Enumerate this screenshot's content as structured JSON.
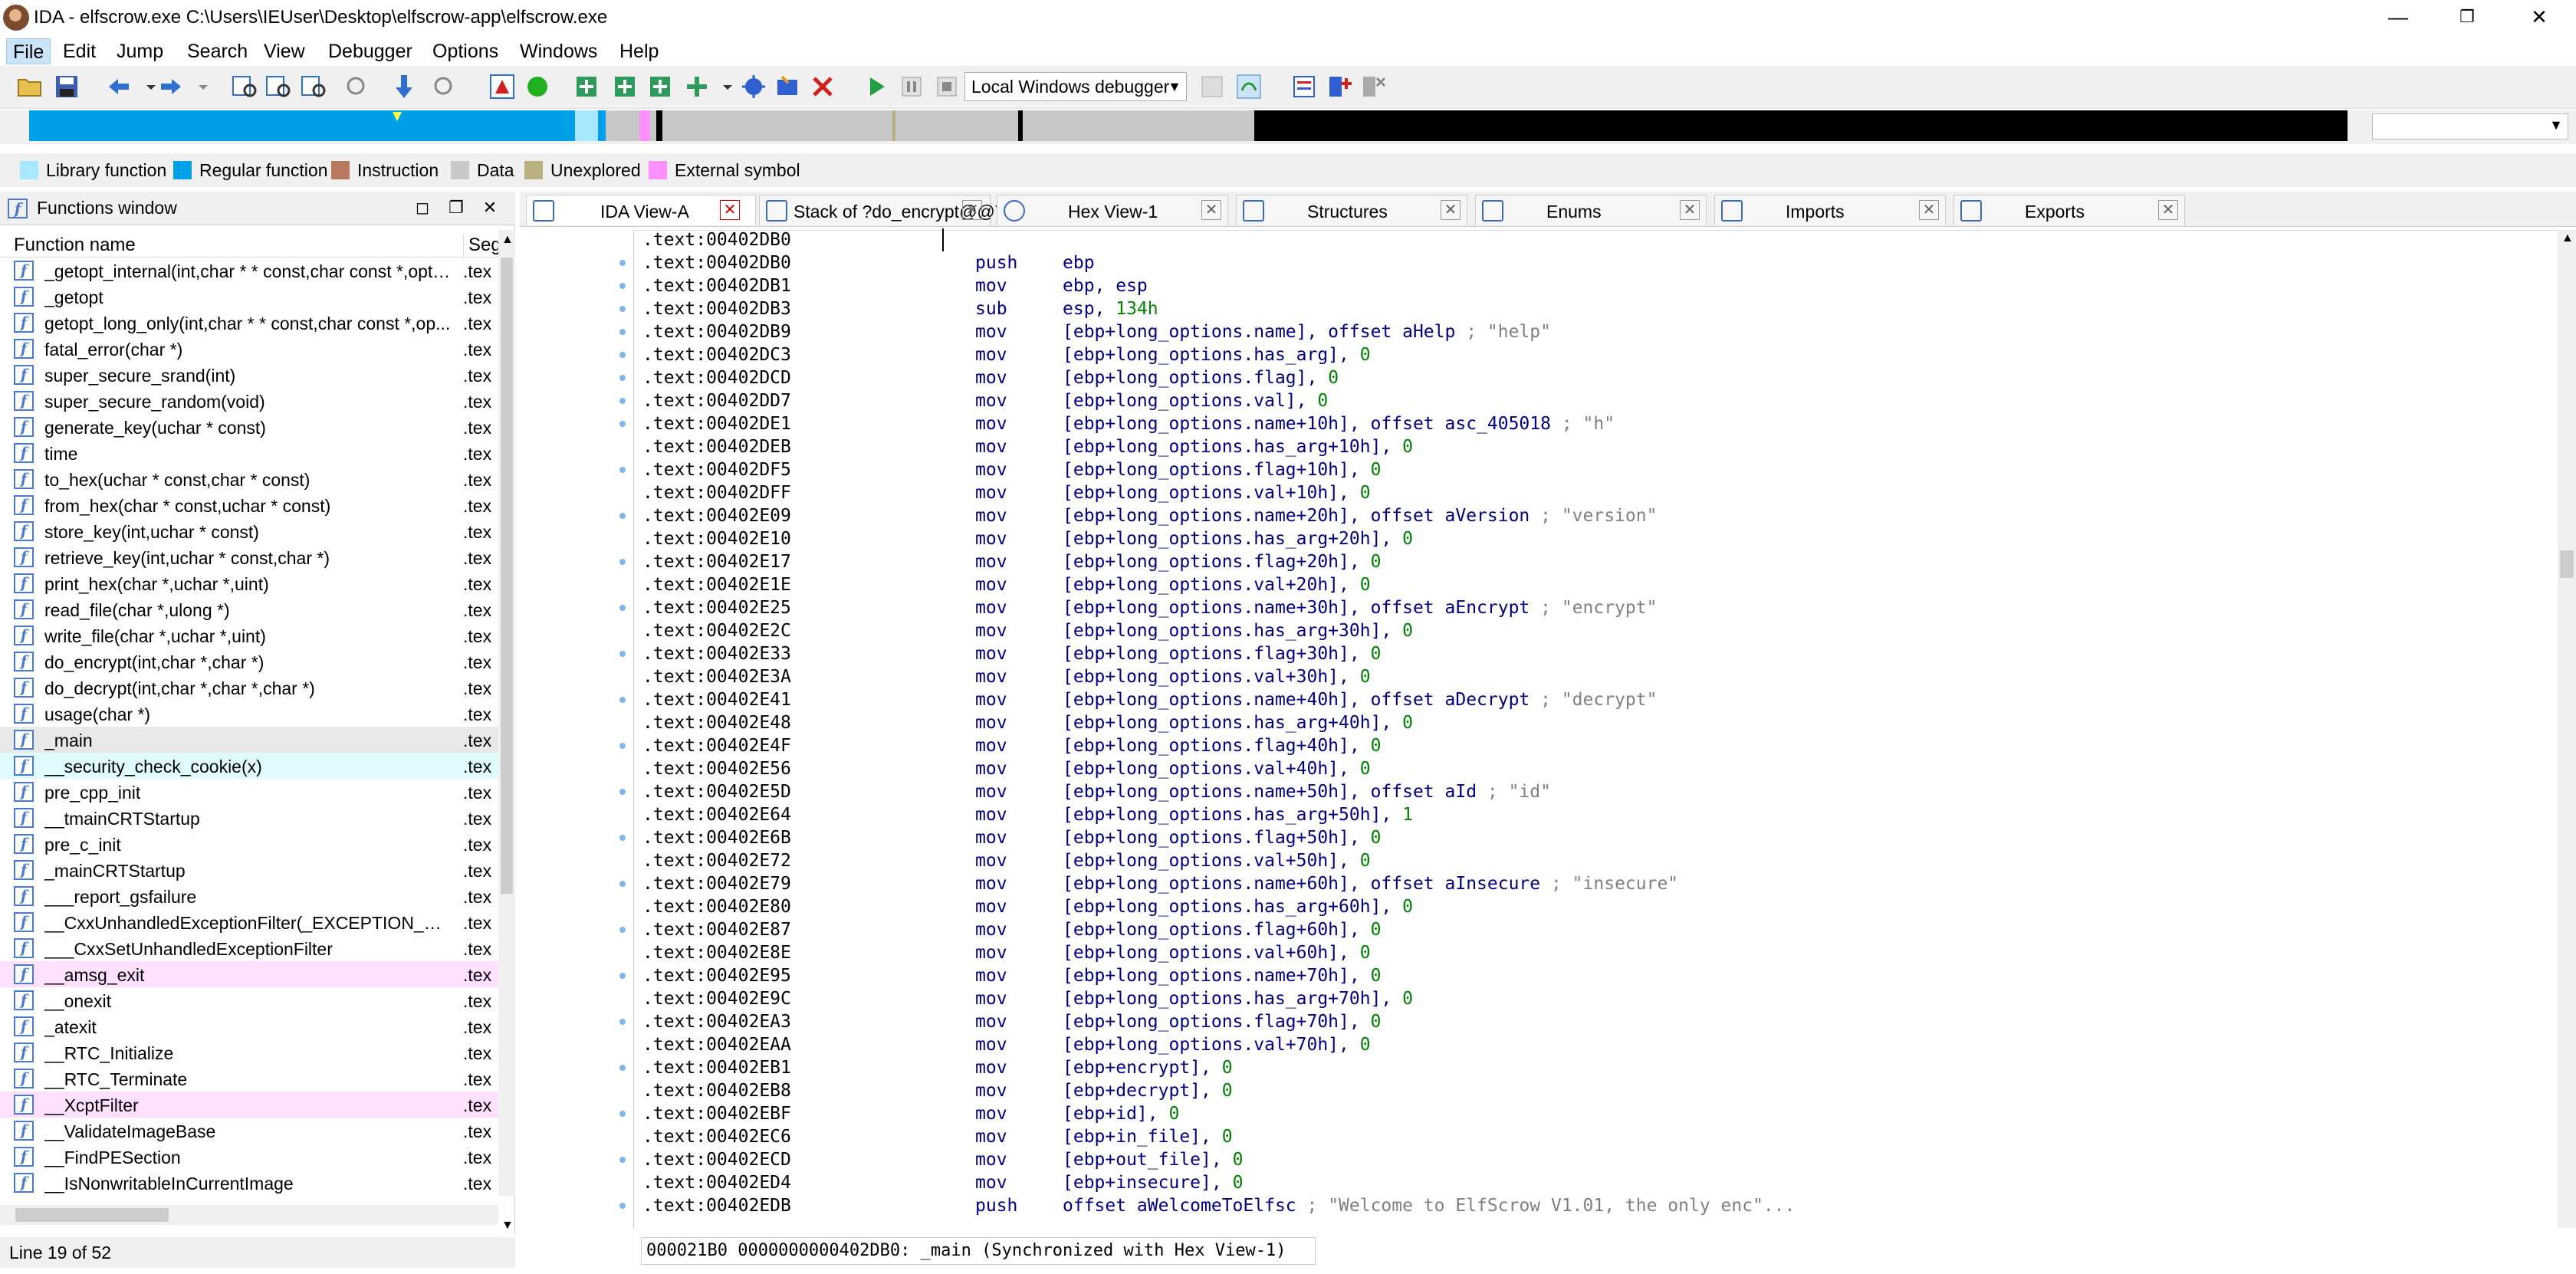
{
  "window": {
    "title": "IDA - elfscrow.exe C:\\Users\\IEUser\\Desktop\\elfscrow-app\\elfscrow.exe",
    "minimize": "—",
    "maximize": "❐",
    "close": "✕"
  },
  "menu": [
    "File",
    "Edit",
    "Jump",
    "Search",
    "View",
    "Debugger",
    "Options",
    "Windows",
    "Help"
  ],
  "toolbar": {
    "debugger_select": "Local Windows debugger"
  },
  "legend": [
    {
      "label": "Library function",
      "color": "#a8e8ff"
    },
    {
      "label": "Regular function",
      "color": "#00a0e8"
    },
    {
      "label": "Instruction",
      "color": "#b87860"
    },
    {
      "label": "Data",
      "color": "#c8c8c8"
    },
    {
      "label": "Unexplored",
      "color": "#b8b080"
    },
    {
      "label": "External symbol",
      "color": "#ff90ff"
    }
  ],
  "functions_window": {
    "title": "Functions window",
    "col_name": "Function name",
    "col_seg": "Seg",
    "rows": [
      {
        "name": "_getopt_internal(int,char * * const,char const *,opti...",
        "seg": ".tex",
        "hl": ""
      },
      {
        "name": "_getopt",
        "seg": ".tex",
        "hl": ""
      },
      {
        "name": "getopt_long_only(int,char * * const,char const *,op...",
        "seg": ".tex",
        "hl": ""
      },
      {
        "name": "fatal_error(char *)",
        "seg": ".tex",
        "hl": ""
      },
      {
        "name": "super_secure_srand(int)",
        "seg": ".tex",
        "hl": ""
      },
      {
        "name": "super_secure_random(void)",
        "seg": ".tex",
        "hl": ""
      },
      {
        "name": "generate_key(uchar * const)",
        "seg": ".tex",
        "hl": ""
      },
      {
        "name": "time",
        "seg": ".tex",
        "hl": ""
      },
      {
        "name": "to_hex(uchar * const,char * const)",
        "seg": ".tex",
        "hl": ""
      },
      {
        "name": "from_hex(char * const,uchar * const)",
        "seg": ".tex",
        "hl": ""
      },
      {
        "name": "store_key(int,uchar * const)",
        "seg": ".tex",
        "hl": ""
      },
      {
        "name": "retrieve_key(int,uchar * const,char *)",
        "seg": ".tex",
        "hl": ""
      },
      {
        "name": "print_hex(char *,uchar *,uint)",
        "seg": ".tex",
        "hl": ""
      },
      {
        "name": "read_file(char *,ulong *)",
        "seg": ".tex",
        "hl": ""
      },
      {
        "name": "write_file(char *,uchar *,uint)",
        "seg": ".tex",
        "hl": ""
      },
      {
        "name": "do_encrypt(int,char *,char *)",
        "seg": ".tex",
        "hl": ""
      },
      {
        "name": "do_decrypt(int,char *,char *,char *)",
        "seg": ".tex",
        "hl": ""
      },
      {
        "name": "usage(char *)",
        "seg": ".tex",
        "hl": ""
      },
      {
        "name": "_main",
        "seg": ".tex",
        "hl": "sel"
      },
      {
        "name": "__security_check_cookie(x)",
        "seg": ".tex",
        "hl": "lib"
      },
      {
        "name": "pre_cpp_init",
        "seg": ".tex",
        "hl": ""
      },
      {
        "name": "__tmainCRTStartup",
        "seg": ".tex",
        "hl": ""
      },
      {
        "name": "pre_c_init",
        "seg": ".tex",
        "hl": ""
      },
      {
        "name": "_mainCRTStartup",
        "seg": ".tex",
        "hl": ""
      },
      {
        "name": "___report_gsfailure",
        "seg": ".tex",
        "hl": ""
      },
      {
        "name": "__CxxUnhandledExceptionFilter(_EXCEPTION_POIN...",
        "seg": ".tex",
        "hl": ""
      },
      {
        "name": "___CxxSetUnhandledExceptionFilter",
        "seg": ".tex",
        "hl": ""
      },
      {
        "name": "__amsg_exit",
        "seg": ".tex",
        "hl": "ext"
      },
      {
        "name": "__onexit",
        "seg": ".tex",
        "hl": ""
      },
      {
        "name": "_atexit",
        "seg": ".tex",
        "hl": ""
      },
      {
        "name": "__RTC_Initialize",
        "seg": ".tex",
        "hl": ""
      },
      {
        "name": "__RTC_Terminate",
        "seg": ".tex",
        "hl": ""
      },
      {
        "name": "__XcptFilter",
        "seg": ".tex",
        "hl": "ext"
      },
      {
        "name": "__ValidateImageBase",
        "seg": ".tex",
        "hl": ""
      },
      {
        "name": "__FindPESection",
        "seg": ".tex",
        "hl": ""
      },
      {
        "name": "__IsNonwritableInCurrentImage",
        "seg": ".tex",
        "hl": ""
      }
    ],
    "status": "Line 19 of 52"
  },
  "tabs": [
    {
      "label": "IDA View-A"
    },
    {
      "label": "Stack of ?do_encrypt@@YAXHPAD0@Z"
    },
    {
      "label": "Hex View-1"
    },
    {
      "label": "Structures"
    },
    {
      "label": "Enums"
    },
    {
      "label": "Imports"
    },
    {
      "label": "Exports"
    }
  ],
  "code": [
    {
      "a": ".text:00402DB0",
      "m": "",
      "o": []
    },
    {
      "a": ".text:00402DB0",
      "m": "push",
      "o": [
        [
          "ebp",
          ""
        ]
      ]
    },
    {
      "a": ".text:00402DB1",
      "m": "mov",
      "o": [
        [
          "ebp, esp",
          ""
        ]
      ]
    },
    {
      "a": ".text:00402DB3",
      "m": "sub",
      "o": [
        [
          "esp, ",
          ""
        ],
        [
          "134h",
          "num"
        ]
      ]
    },
    {
      "a": ".text:00402DB9",
      "m": "mov",
      "o": [
        [
          "[ebp+long_options.name], offset aHelp ",
          ""
        ],
        [
          "; \"help\"",
          "cmt"
        ]
      ]
    },
    {
      "a": ".text:00402DC3",
      "m": "mov",
      "o": [
        [
          "[ebp+long_options.has_arg], ",
          ""
        ],
        [
          "0",
          "num"
        ]
      ]
    },
    {
      "a": ".text:00402DCD",
      "m": "mov",
      "o": [
        [
          "[ebp+long_options.flag], ",
          ""
        ],
        [
          "0",
          "num"
        ]
      ]
    },
    {
      "a": ".text:00402DD7",
      "m": "mov",
      "o": [
        [
          "[ebp+long_options.val], ",
          ""
        ],
        [
          "0",
          "num"
        ]
      ]
    },
    {
      "a": ".text:00402DE1",
      "m": "mov",
      "o": [
        [
          "[ebp+long_options.name+10h], offset asc_405018 ",
          ""
        ],
        [
          "; \"h\"",
          "cmt"
        ]
      ]
    },
    {
      "a": ".text:00402DEB",
      "m": "mov",
      "o": [
        [
          "[ebp+long_options.has_arg+10h], ",
          ""
        ],
        [
          "0",
          "num"
        ]
      ]
    },
    {
      "a": ".text:00402DF5",
      "m": "mov",
      "o": [
        [
          "[ebp+long_options.flag+10h], ",
          ""
        ],
        [
          "0",
          "num"
        ]
      ]
    },
    {
      "a": ".text:00402DFF",
      "m": "mov",
      "o": [
        [
          "[ebp+long_options.val+10h], ",
          ""
        ],
        [
          "0",
          "num"
        ]
      ]
    },
    {
      "a": ".text:00402E09",
      "m": "mov",
      "o": [
        [
          "[ebp+long_options.name+20h], offset aVersion ",
          ""
        ],
        [
          "; \"version\"",
          "cmt"
        ]
      ]
    },
    {
      "a": ".text:00402E10",
      "m": "mov",
      "o": [
        [
          "[ebp+long_options.has_arg+20h], ",
          ""
        ],
        [
          "0",
          "num"
        ]
      ]
    },
    {
      "a": ".text:00402E17",
      "m": "mov",
      "o": [
        [
          "[ebp+long_options.flag+20h], ",
          ""
        ],
        [
          "0",
          "num"
        ]
      ]
    },
    {
      "a": ".text:00402E1E",
      "m": "mov",
      "o": [
        [
          "[ebp+long_options.val+20h], ",
          ""
        ],
        [
          "0",
          "num"
        ]
      ]
    },
    {
      "a": ".text:00402E25",
      "m": "mov",
      "o": [
        [
          "[ebp+long_options.name+30h], offset aEncrypt ",
          ""
        ],
        [
          "; \"encrypt\"",
          "cmt"
        ]
      ]
    },
    {
      "a": ".text:00402E2C",
      "m": "mov",
      "o": [
        [
          "[ebp+long_options.has_arg+30h], ",
          ""
        ],
        [
          "0",
          "num"
        ]
      ]
    },
    {
      "a": ".text:00402E33",
      "m": "mov",
      "o": [
        [
          "[ebp+long_options.flag+30h], ",
          ""
        ],
        [
          "0",
          "num"
        ]
      ]
    },
    {
      "a": ".text:00402E3A",
      "m": "mov",
      "o": [
        [
          "[ebp+long_options.val+30h], ",
          ""
        ],
        [
          "0",
          "num"
        ]
      ]
    },
    {
      "a": ".text:00402E41",
      "m": "mov",
      "o": [
        [
          "[ebp+long_options.name+40h], offset aDecrypt ",
          ""
        ],
        [
          "; \"decrypt\"",
          "cmt"
        ]
      ]
    },
    {
      "a": ".text:00402E48",
      "m": "mov",
      "o": [
        [
          "[ebp+long_options.has_arg+40h], ",
          ""
        ],
        [
          "0",
          "num"
        ]
      ]
    },
    {
      "a": ".text:00402E4F",
      "m": "mov",
      "o": [
        [
          "[ebp+long_options.flag+40h], ",
          ""
        ],
        [
          "0",
          "num"
        ]
      ]
    },
    {
      "a": ".text:00402E56",
      "m": "mov",
      "o": [
        [
          "[ebp+long_options.val+40h], ",
          ""
        ],
        [
          "0",
          "num"
        ]
      ]
    },
    {
      "a": ".text:00402E5D",
      "m": "mov",
      "o": [
        [
          "[ebp+long_options.name+50h], offset aId ",
          ""
        ],
        [
          "; \"id\"",
          "cmt"
        ]
      ]
    },
    {
      "a": ".text:00402E64",
      "m": "mov",
      "o": [
        [
          "[ebp+long_options.has_arg+50h], ",
          ""
        ],
        [
          "1",
          "num"
        ]
      ]
    },
    {
      "a": ".text:00402E6B",
      "m": "mov",
      "o": [
        [
          "[ebp+long_options.flag+50h], ",
          ""
        ],
        [
          "0",
          "num"
        ]
      ]
    },
    {
      "a": ".text:00402E72",
      "m": "mov",
      "o": [
        [
          "[ebp+long_options.val+50h], ",
          ""
        ],
        [
          "0",
          "num"
        ]
      ]
    },
    {
      "a": ".text:00402E79",
      "m": "mov",
      "o": [
        [
          "[ebp+long_options.name+60h], offset aInsecure ",
          ""
        ],
        [
          "; \"insecure\"",
          "cmt"
        ]
      ]
    },
    {
      "a": ".text:00402E80",
      "m": "mov",
      "o": [
        [
          "[ebp+long_options.has_arg+60h], ",
          ""
        ],
        [
          "0",
          "num"
        ]
      ]
    },
    {
      "a": ".text:00402E87",
      "m": "mov",
      "o": [
        [
          "[ebp+long_options.flag+60h], ",
          ""
        ],
        [
          "0",
          "num"
        ]
      ]
    },
    {
      "a": ".text:00402E8E",
      "m": "mov",
      "o": [
        [
          "[ebp+long_options.val+60h], ",
          ""
        ],
        [
          "0",
          "num"
        ]
      ]
    },
    {
      "a": ".text:00402E95",
      "m": "mov",
      "o": [
        [
          "[ebp+long_options.name+70h], ",
          ""
        ],
        [
          "0",
          "num"
        ]
      ]
    },
    {
      "a": ".text:00402E9C",
      "m": "mov",
      "o": [
        [
          "[ebp+long_options.has_arg+70h], ",
          ""
        ],
        [
          "0",
          "num"
        ]
      ]
    },
    {
      "a": ".text:00402EA3",
      "m": "mov",
      "o": [
        [
          "[ebp+long_options.flag+70h], ",
          ""
        ],
        [
          "0",
          "num"
        ]
      ]
    },
    {
      "a": ".text:00402EAA",
      "m": "mov",
      "o": [
        [
          "[ebp+long_options.val+70h], ",
          ""
        ],
        [
          "0",
          "num"
        ]
      ]
    },
    {
      "a": ".text:00402EB1",
      "m": "mov",
      "o": [
        [
          "[ebp+encrypt], ",
          ""
        ],
        [
          "0",
          "num"
        ]
      ]
    },
    {
      "a": ".text:00402EB8",
      "m": "mov",
      "o": [
        [
          "[ebp+decrypt], ",
          ""
        ],
        [
          "0",
          "num"
        ]
      ]
    },
    {
      "a": ".text:00402EBF",
      "m": "mov",
      "o": [
        [
          "[ebp+id], ",
          ""
        ],
        [
          "0",
          "num"
        ]
      ]
    },
    {
      "a": ".text:00402EC6",
      "m": "mov",
      "o": [
        [
          "[ebp+in_file], ",
          ""
        ],
        [
          "0",
          "num"
        ]
      ]
    },
    {
      "a": ".text:00402ECD",
      "m": "mov",
      "o": [
        [
          "[ebp+out_file], ",
          ""
        ],
        [
          "0",
          "num"
        ]
      ]
    },
    {
      "a": ".text:00402ED4",
      "m": "mov",
      "o": [
        [
          "[ebp+insecure], ",
          ""
        ],
        [
          "0",
          "num"
        ]
      ]
    },
    {
      "a": ".text:00402EDB",
      "m": "push",
      "o": [
        [
          "offset aWelcomeToElfsc ",
          ""
        ],
        [
          "; \"Welcome to ElfScrow V1.01, the only enc\"...",
          "cmt"
        ]
      ]
    }
  ],
  "code_status": "000021B0 0000000000402DB0: _main (Synchronized with Hex View-1)"
}
